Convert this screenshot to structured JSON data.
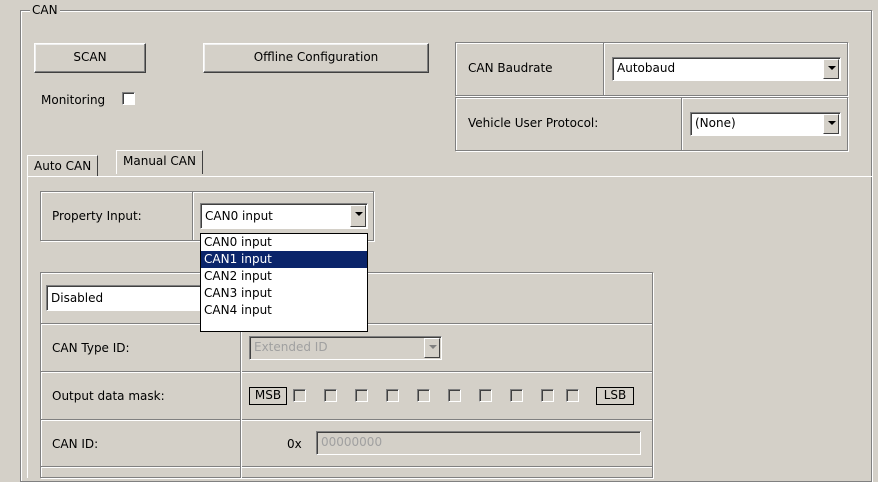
{
  "group": {
    "title": "CAN"
  },
  "buttons": {
    "scan": "SCAN",
    "offline": "Offline Configuration"
  },
  "monitoring": {
    "label": "Monitoring",
    "checked": false
  },
  "baudrate": {
    "label": "CAN Baudrate",
    "value": "Autobaud"
  },
  "vehicle_protocol": {
    "label": "Vehicle User Protocol:",
    "value": "(None)"
  },
  "tabs": [
    {
      "label": "Auto CAN",
      "active": false
    },
    {
      "label": "Manual CAN",
      "active": true
    }
  ],
  "property_input": {
    "label": "Property Input:",
    "value": "CAN0 input",
    "options": [
      "CAN0 input",
      "CAN1 input",
      "CAN2 input",
      "CAN3 input",
      "CAN4 input"
    ],
    "highlighted": "CAN1 input"
  },
  "mode": {
    "value": "Disabled"
  },
  "can_type": {
    "label": "CAN Type ID:",
    "value": "Extended ID"
  },
  "output_mask": {
    "label": "Output data mask:",
    "msb": "MSB",
    "lsb": "LSB"
  },
  "can_id": {
    "label": "CAN ID:",
    "prefix": "0x",
    "value": "00000000"
  }
}
